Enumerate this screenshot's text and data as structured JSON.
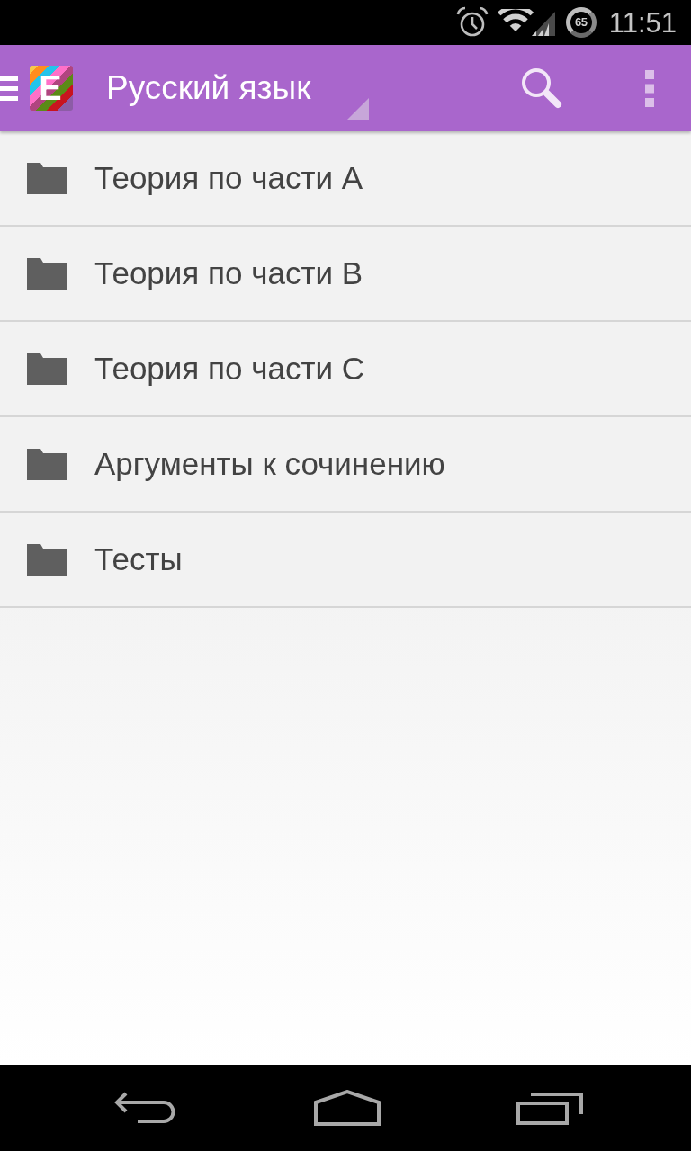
{
  "status_bar": {
    "battery": "65",
    "time": "11:51"
  },
  "app_bar": {
    "logo_letter": "E",
    "title": "Русский язык"
  },
  "folders": [
    {
      "label": "Теория по части A"
    },
    {
      "label": "Теория по части B"
    },
    {
      "label": "Теория по части C"
    },
    {
      "label": "Аргументы к сочинению"
    },
    {
      "label": "Тесты"
    }
  ]
}
